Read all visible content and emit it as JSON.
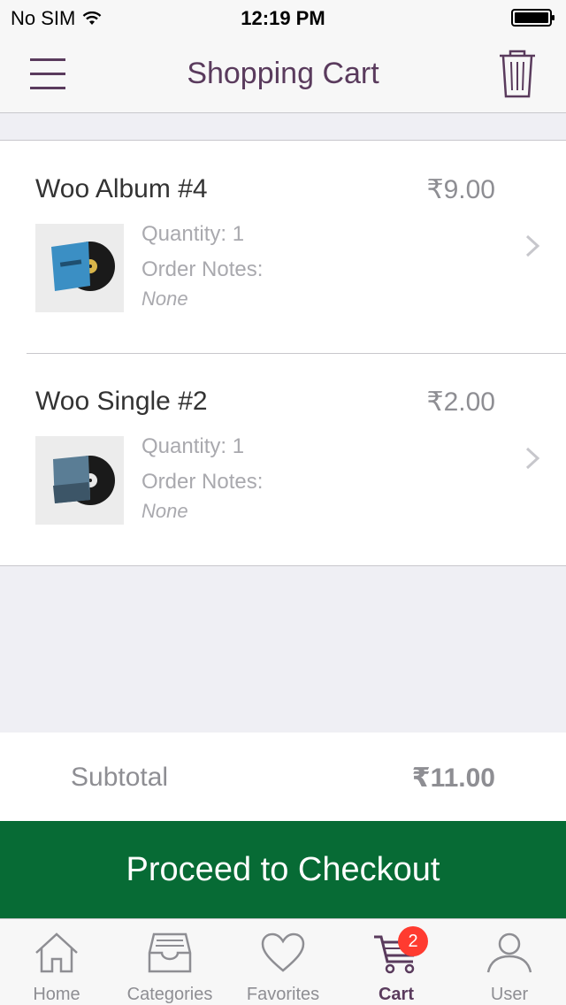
{
  "status_bar": {
    "carrier": "No SIM",
    "time": "12:19 PM"
  },
  "nav": {
    "title": "Shopping Cart",
    "menu_icon": "hamburger-menu-icon",
    "trash_icon": "trash-icon"
  },
  "cart_items": [
    {
      "name": "Woo Album #4",
      "price": "₹9.00",
      "quantity": "Quantity: 1",
      "notes_label": "Order Notes:",
      "notes_value": "None",
      "thumb_color": "#3b8fc4"
    },
    {
      "name": "Woo Single #2",
      "price": "₹2.00",
      "quantity": "Quantity: 1",
      "notes_label": "Order Notes:",
      "notes_value": "None",
      "thumb_color": "#5a7d95"
    }
  ],
  "subtotal": {
    "label": "Subtotal",
    "amount": "₹11.00"
  },
  "checkout": {
    "label": "Proceed to Checkout",
    "color": "#076b35"
  },
  "tabs": [
    {
      "label": "Home",
      "icon": "home-icon"
    },
    {
      "label": "Categories",
      "icon": "tray-icon"
    },
    {
      "label": "Favorites",
      "icon": "heart-icon"
    },
    {
      "label": "Cart",
      "icon": "cart-icon",
      "badge": "2",
      "active": true
    },
    {
      "label": "User",
      "icon": "user-icon"
    }
  ],
  "colors": {
    "accent": "#5a3b5d",
    "badge": "#ff3b30"
  }
}
